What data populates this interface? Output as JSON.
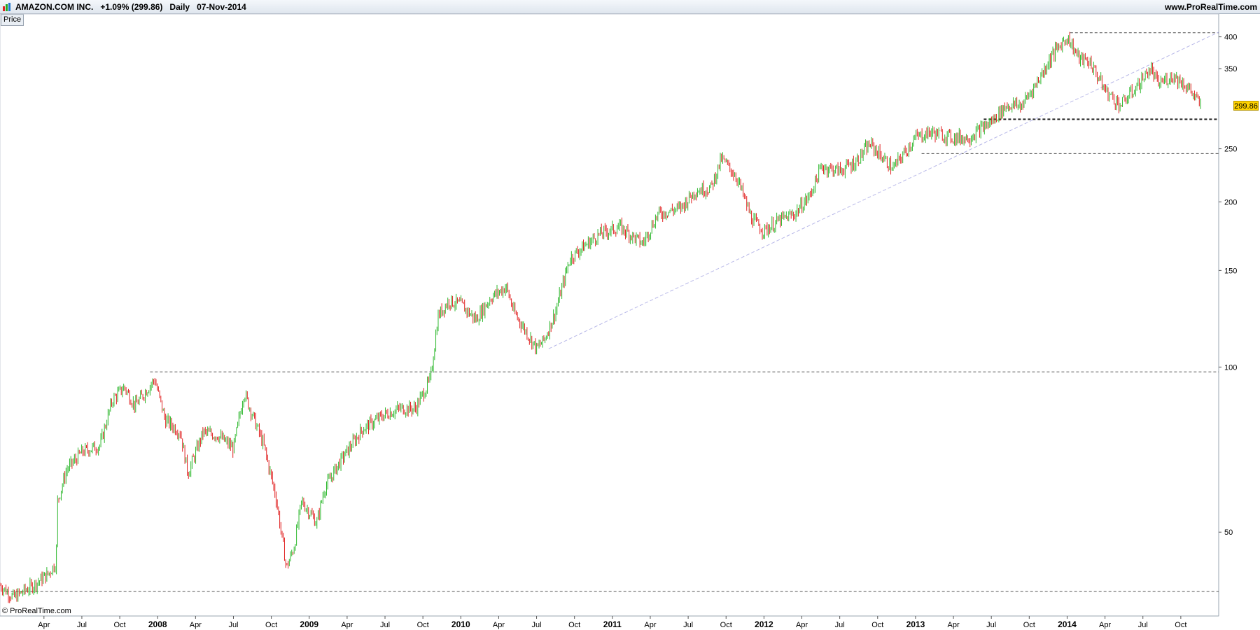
{
  "header": {
    "instrument": "AMAZON.COM INC.",
    "change": "+1.09% (299.86)",
    "period": "Daily",
    "date": "07-Nov-2014",
    "brand": "www.ProRealTime.com"
  },
  "panel_tab": "Price",
  "copyright": "© ProRealTime.com",
  "last_price_label": "299.86",
  "colors": {
    "up": "#2eb82e",
    "down": "#e02020",
    "trendline": "#b8b8e8",
    "level": "#555555",
    "last_bg": "#ffd200"
  },
  "chart_data": {
    "type": "line",
    "scale": "log",
    "ylim": [
      36,
      430
    ],
    "y_ticks": [
      50,
      100,
      150,
      200,
      250,
      350,
      400
    ],
    "x_ticks": [
      {
        "label": "Apr",
        "t": 2007.25,
        "year": false
      },
      {
        "label": "Jul",
        "t": 2007.5,
        "year": false
      },
      {
        "label": "Oct",
        "t": 2007.75,
        "year": false
      },
      {
        "label": "2008",
        "t": 2008.0,
        "year": true
      },
      {
        "label": "Apr",
        "t": 2008.25,
        "year": false
      },
      {
        "label": "Jul",
        "t": 2008.5,
        "year": false
      },
      {
        "label": "Oct",
        "t": 2008.75,
        "year": false
      },
      {
        "label": "2009",
        "t": 2009.0,
        "year": true
      },
      {
        "label": "Apr",
        "t": 2009.25,
        "year": false
      },
      {
        "label": "Jul",
        "t": 2009.5,
        "year": false
      },
      {
        "label": "Oct",
        "t": 2009.75,
        "year": false
      },
      {
        "label": "2010",
        "t": 2010.0,
        "year": true
      },
      {
        "label": "Apr",
        "t": 2010.25,
        "year": false
      },
      {
        "label": "Jul",
        "t": 2010.5,
        "year": false
      },
      {
        "label": "Oct",
        "t": 2010.75,
        "year": false
      },
      {
        "label": "2011",
        "t": 2011.0,
        "year": true
      },
      {
        "label": "Apr",
        "t": 2011.25,
        "year": false
      },
      {
        "label": "Jul",
        "t": 2011.5,
        "year": false
      },
      {
        "label": "Oct",
        "t": 2011.75,
        "year": false
      },
      {
        "label": "2012",
        "t": 2012.0,
        "year": true
      },
      {
        "label": "Apr",
        "t": 2012.25,
        "year": false
      },
      {
        "label": "Jul",
        "t": 2012.5,
        "year": false
      },
      {
        "label": "Oct",
        "t": 2012.75,
        "year": false
      },
      {
        "label": "2013",
        "t": 2013.0,
        "year": true
      },
      {
        "label": "Apr",
        "t": 2013.25,
        "year": false
      },
      {
        "label": "Jul",
        "t": 2013.5,
        "year": false
      },
      {
        "label": "Oct",
        "t": 2013.75,
        "year": false
      },
      {
        "label": "2014",
        "t": 2014.0,
        "year": true
      },
      {
        "label": "Apr",
        "t": 2014.25,
        "year": false
      },
      {
        "label": "Jul",
        "t": 2014.5,
        "year": false
      },
      {
        "label": "Oct",
        "t": 2014.75,
        "year": false
      }
    ],
    "xlim": [
      2006.96,
      2015.0
    ],
    "price_path": [
      [
        2006.96,
        40
      ],
      [
        2007.05,
        38
      ],
      [
        2007.18,
        40
      ],
      [
        2007.28,
        42
      ],
      [
        2007.33,
        44
      ],
      [
        2007.34,
        57
      ],
      [
        2007.4,
        65
      ],
      [
        2007.5,
        70
      ],
      [
        2007.62,
        72
      ],
      [
        2007.7,
        87
      ],
      [
        2007.78,
        92
      ],
      [
        2007.85,
        85
      ],
      [
        2007.98,
        95
      ],
      [
        2008.05,
        80
      ],
      [
        2008.15,
        76
      ],
      [
        2008.2,
        64
      ],
      [
        2008.3,
        76
      ],
      [
        2008.4,
        75
      ],
      [
        2008.5,
        71
      ],
      [
        2008.57,
        90
      ],
      [
        2008.7,
        72
      ],
      [
        2008.78,
        58
      ],
      [
        2008.85,
        43
      ],
      [
        2008.9,
        47
      ],
      [
        2008.95,
        57
      ],
      [
        2009.05,
        52
      ],
      [
        2009.1,
        60
      ],
      [
        2009.2,
        67
      ],
      [
        2009.35,
        77
      ],
      [
        2009.5,
        82
      ],
      [
        2009.6,
        84
      ],
      [
        2009.7,
        84
      ],
      [
        2009.8,
        95
      ],
      [
        2009.85,
        124
      ],
      [
        2009.92,
        132
      ],
      [
        2010.0,
        130
      ],
      [
        2010.1,
        122
      ],
      [
        2010.2,
        134
      ],
      [
        2010.3,
        140
      ],
      [
        2010.35,
        126
      ],
      [
        2010.5,
        108
      ],
      [
        2010.55,
        112
      ],
      [
        2010.62,
        125
      ],
      [
        2010.72,
        158
      ],
      [
        2010.8,
        165
      ],
      [
        2010.92,
        175
      ],
      [
        2011.05,
        180
      ],
      [
        2011.2,
        168
      ],
      [
        2011.3,
        190
      ],
      [
        2011.45,
        195
      ],
      [
        2011.55,
        210
      ],
      [
        2011.65,
        212
      ],
      [
        2011.72,
        240
      ],
      [
        2011.82,
        222
      ],
      [
        2011.92,
        186
      ],
      [
        2012.0,
        177
      ],
      [
        2012.1,
        185
      ],
      [
        2012.2,
        190
      ],
      [
        2012.3,
        205
      ],
      [
        2012.38,
        232
      ],
      [
        2012.5,
        228
      ],
      [
        2012.6,
        236
      ],
      [
        2012.7,
        255
      ],
      [
        2012.85,
        230
      ],
      [
        2013.0,
        262
      ],
      [
        2013.1,
        268
      ],
      [
        2013.25,
        262
      ],
      [
        2013.35,
        262
      ],
      [
        2013.5,
        280
      ],
      [
        2013.6,
        300
      ],
      [
        2013.7,
        300
      ],
      [
        2013.8,
        330
      ],
      [
        2013.9,
        370
      ],
      [
        2014.0,
        400
      ],
      [
        2014.08,
        365
      ],
      [
        2014.15,
        360
      ],
      [
        2014.25,
        320
      ],
      [
        2014.35,
        300
      ],
      [
        2014.45,
        322
      ],
      [
        2014.55,
        350
      ],
      [
        2014.6,
        328
      ],
      [
        2014.7,
        340
      ],
      [
        2014.8,
        323
      ],
      [
        2014.88,
        299.86
      ]
    ],
    "levels": [
      {
        "t0": 2007.0,
        "t1": 2015.0,
        "y": 39
      },
      {
        "t0": 2007.95,
        "t1": 2015.0,
        "y": 98
      },
      {
        "t0": 2013.04,
        "t1": 2015.0,
        "y": 245
      },
      {
        "t0": 2014.02,
        "t1": 2015.0,
        "y": 407
      }
    ],
    "support_levels": [
      {
        "t0": 2013.45,
        "t1": 2015.0,
        "y": 283
      }
    ],
    "trendline": {
      "t0": 2010.58,
      "y0": 108,
      "t1": 2015.0,
      "y1": 408
    },
    "last_value": 299.86
  }
}
